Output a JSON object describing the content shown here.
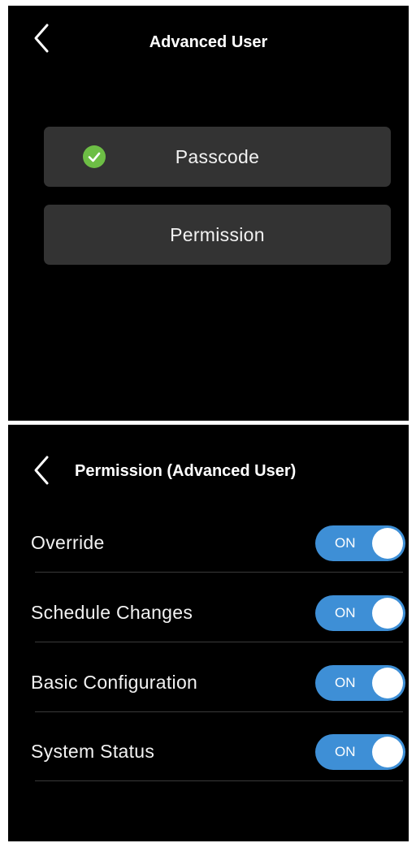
{
  "screen1": {
    "title": "Advanced User",
    "buttons": [
      {
        "label": "Passcode",
        "checked": true,
        "icon": "check-circle-icon"
      },
      {
        "label": "Permission",
        "checked": false
      }
    ]
  },
  "screen2": {
    "title": "Permission (Advanced User)",
    "permissions": [
      {
        "label": "Override",
        "toggle": "ON"
      },
      {
        "label": "Schedule Changes",
        "toggle": "ON"
      },
      {
        "label": "Basic Configuration",
        "toggle": "ON"
      },
      {
        "label": "System Status",
        "toggle": "ON"
      }
    ]
  },
  "colors": {
    "background": "#000000",
    "button": "#333333",
    "toggle_on": "#3e8fd6",
    "check": "#6dbe45",
    "divider": "#3a3a3a"
  }
}
